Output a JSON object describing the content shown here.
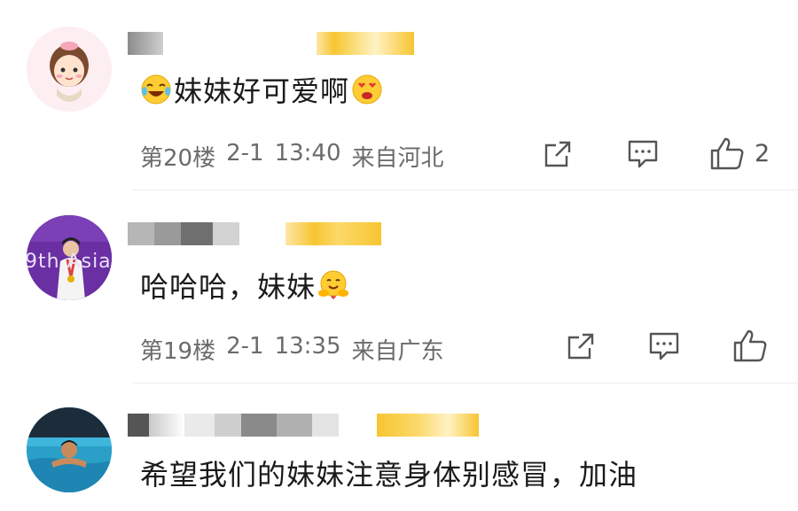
{
  "comments": [
    {
      "text": "妹妹好可爱啊",
      "floor": "第20楼",
      "date": "2-1",
      "time": "13:40",
      "location": "来自河北",
      "like_count": "2"
    },
    {
      "text": "哈哈哈，妹妹",
      "floor": "第19楼",
      "date": "2-1",
      "time": "13:35",
      "location": "来自广东",
      "like_count": ""
    },
    {
      "text": "希望我们的妹妹注意身体别感冒，加油"
    }
  ],
  "avatar_texts": {
    "second_avatar_caption": "9th Asia"
  },
  "icons": {
    "share": "share-icon",
    "comment": "comment-icon",
    "like": "thumbs-up-icon"
  },
  "colors": {
    "text": "#1a1a1a",
    "meta": "#6b6b6b",
    "icon": "#555555",
    "badge": "#f7c531",
    "divider": "#ececec",
    "avatar2_bg": "#6a2fa3",
    "avatar3_water": "#2a9fc7"
  }
}
